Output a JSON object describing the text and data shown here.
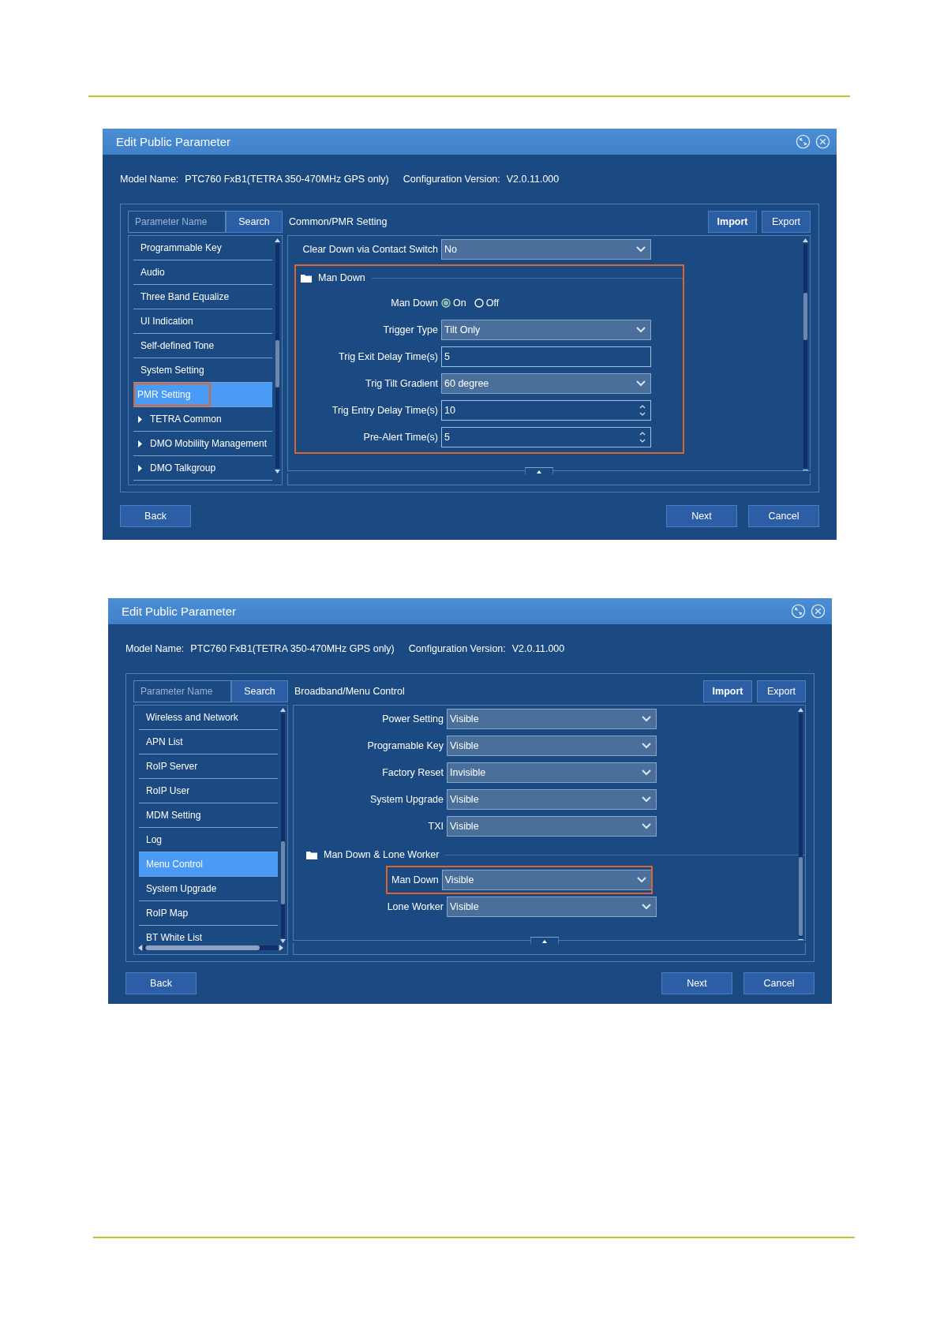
{
  "windows": [
    {
      "title": "Edit Public Parameter",
      "model_label": "Model Name:",
      "model_value": "PTC760 FxB1(TETRA 350-470MHz GPS only)",
      "version_label": "Configuration Version:",
      "version_value": "V2.0.11.000",
      "search": {
        "placeholder": "Parameter Name",
        "button": "Search"
      },
      "breadcrumb": "Common/PMR Setting",
      "top_buttons": [
        "Import",
        "Export"
      ],
      "nav_hscroll": false,
      "nav_items": [
        {
          "label": "Programmable Key",
          "selected": false,
          "highlighted": false
        },
        {
          "label": "Audio",
          "selected": false,
          "highlighted": false
        },
        {
          "label": "Three Band Equalize",
          "selected": false,
          "highlighted": false
        },
        {
          "label": "UI Indication",
          "selected": false,
          "highlighted": false
        },
        {
          "label": "Self-defined Tone",
          "selected": false,
          "highlighted": false
        },
        {
          "label": "System Setting",
          "selected": false,
          "highlighted": false
        },
        {
          "label": "PMR Setting",
          "selected": true,
          "highlighted": true
        },
        {
          "label": "TETRA Common",
          "selected": false,
          "highlighted": false,
          "expanded": false
        },
        {
          "label": "DMO Mobililty Management",
          "selected": false,
          "highlighted": false,
          "expanded": false
        },
        {
          "label": "DMO Talkgroup",
          "selected": false,
          "highlighted": false,
          "expanded": false
        }
      ],
      "settings": [
        {
          "kind": "dropdown",
          "label": "Clear Down via Contact Switch",
          "value": "No",
          "highlighted": false
        },
        {
          "kind": "group",
          "title": "Man Down",
          "highlighted": true,
          "rows": [
            {
              "kind": "radio",
              "label": "Man Down",
              "options": [
                {
                  "label": "On",
                  "selected": true
                },
                {
                  "label": "Off",
                  "selected": false
                }
              ],
              "highlighted": false
            },
            {
              "kind": "dropdown",
              "label": "Trigger Type",
              "value": "Tilt Only",
              "highlighted": false
            },
            {
              "kind": "text",
              "label": "Trig Exit Delay Time(s)",
              "value": "5",
              "highlighted": false
            },
            {
              "kind": "dropdown",
              "label": "Trig Tilt Gradient",
              "value": "60 degree",
              "highlighted": false
            },
            {
              "kind": "spin",
              "label": "Trig Entry Delay Time(s)",
              "value": "10",
              "highlighted": false
            },
            {
              "kind": "spin",
              "label": "Pre-Alert Time(s)",
              "value": "5",
              "highlighted": false
            }
          ]
        }
      ],
      "footer_buttons": {
        "back": "Back",
        "next": "Next",
        "cancel": "Cancel"
      }
    },
    {
      "title": "Edit Public Parameter",
      "model_label": "Model Name:",
      "model_value": "PTC760 FxB1(TETRA 350-470MHz GPS only)",
      "version_label": "Configuration Version:",
      "version_value": "V2.0.11.000",
      "search": {
        "placeholder": "Parameter Name",
        "button": "Search"
      },
      "breadcrumb": "Broadband/Menu Control",
      "top_buttons": [
        "Import",
        "Export"
      ],
      "nav_hscroll": true,
      "nav_items": [
        {
          "label": "Wireless and Network",
          "selected": false,
          "highlighted": false
        },
        {
          "label": "APN List",
          "selected": false,
          "highlighted": false
        },
        {
          "label": "RoIP Server",
          "selected": false,
          "highlighted": false
        },
        {
          "label": "RoIP User",
          "selected": false,
          "highlighted": false
        },
        {
          "label": "MDM Setting",
          "selected": false,
          "highlighted": false
        },
        {
          "label": "Log",
          "selected": false,
          "highlighted": false
        },
        {
          "label": "Menu Control",
          "selected": true,
          "highlighted": false
        },
        {
          "label": "System Upgrade",
          "selected": false,
          "highlighted": false
        },
        {
          "label": "RoIP Map",
          "selected": false,
          "highlighted": false
        },
        {
          "label": "BT White List",
          "selected": false,
          "highlighted": false
        }
      ],
      "settings": [
        {
          "kind": "dropdown",
          "label": "Power Setting",
          "value": "Visible",
          "highlighted": false
        },
        {
          "kind": "dropdown",
          "label": "Programable Key",
          "value": "Visible",
          "highlighted": false
        },
        {
          "kind": "dropdown",
          "label": "Factory Reset",
          "value": "Invisible",
          "highlighted": false
        },
        {
          "kind": "dropdown",
          "label": "System Upgrade",
          "value": "Visible",
          "highlighted": false
        },
        {
          "kind": "dropdown",
          "label": "TXI",
          "value": "Visible",
          "highlighted": false
        },
        {
          "kind": "group",
          "title": "Man Down & Lone Worker",
          "highlighted": false,
          "rows": [
            {
              "kind": "dropdown",
              "label": "Man Down",
              "value": "Visible",
              "highlighted": true
            },
            {
              "kind": "dropdown",
              "label": "Lone Worker",
              "value": "Visible",
              "highlighted": false
            }
          ]
        }
      ],
      "footer_buttons": {
        "back": "Back",
        "next": "Next",
        "cancel": "Cancel"
      }
    }
  ]
}
